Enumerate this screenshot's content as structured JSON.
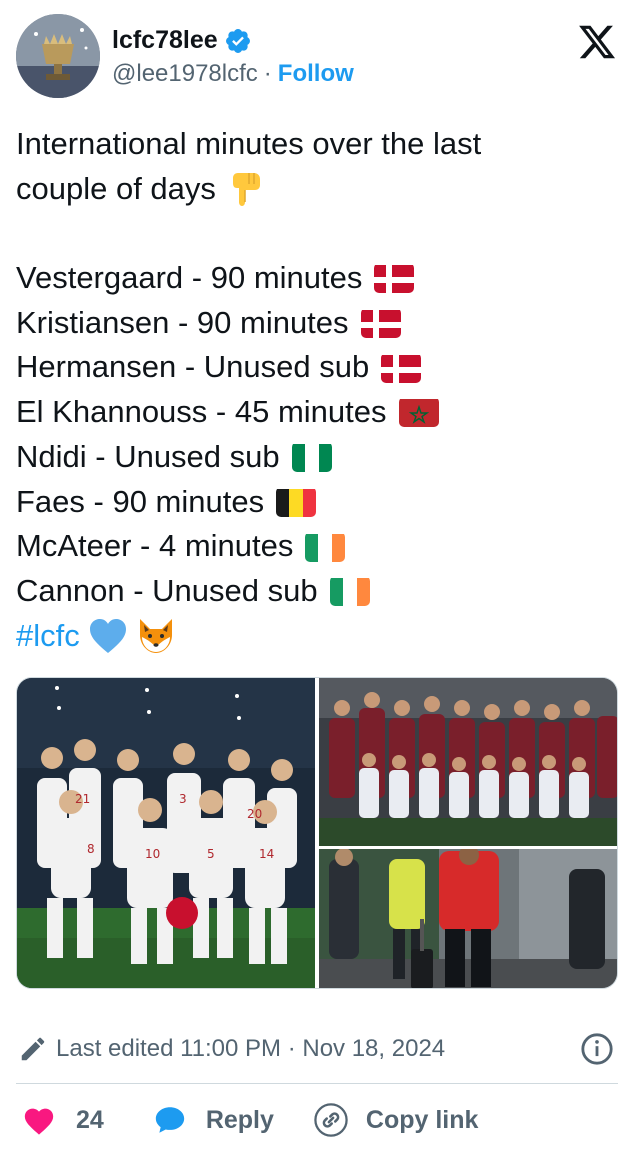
{
  "author": {
    "display_name": "lcfc78lee",
    "handle": "@lee1978lcfc",
    "separator": "·",
    "follow_label": "Follow"
  },
  "tweet": {
    "intro_line1": "International minutes over the last",
    "intro_line2": "couple of days",
    "players": [
      {
        "text": "Vestergaard - 90 minutes",
        "flag": "denmark"
      },
      {
        "text": "Kristiansen - 90 minutes",
        "flag": "denmark"
      },
      {
        "text": "Hermansen - Unused sub",
        "flag": "denmark"
      },
      {
        "text": "El Khannouss - 45 minutes",
        "flag": "morocco"
      },
      {
        "text": "Ndidi - Unused sub",
        "flag": "nigeria"
      },
      {
        "text": "Faes - 90 minutes",
        "flag": "belgium"
      },
      {
        "text": "McAteer - 4 minutes",
        "flag": "ireland"
      },
      {
        "text": "Cannon - Unused sub",
        "flag": "ireland"
      }
    ],
    "hashtag": "#lcfc"
  },
  "footer": {
    "edited_text": "Last edited 11:00 PM · Nov 18, 2024",
    "like_count": "24",
    "reply_label": "Reply",
    "copy_link_label": "Copy link"
  },
  "colors": {
    "accent": "#1d9bf0",
    "text_secondary": "#536471",
    "like": "#f91880",
    "divider": "#cfd9de"
  },
  "icons": {
    "verified": "verified-badge-icon",
    "x_logo": "x-logo-icon",
    "pencil": "pencil-icon",
    "info": "info-icon",
    "heart": "heart-icon",
    "reply": "reply-bubble-icon",
    "link": "link-icon"
  }
}
